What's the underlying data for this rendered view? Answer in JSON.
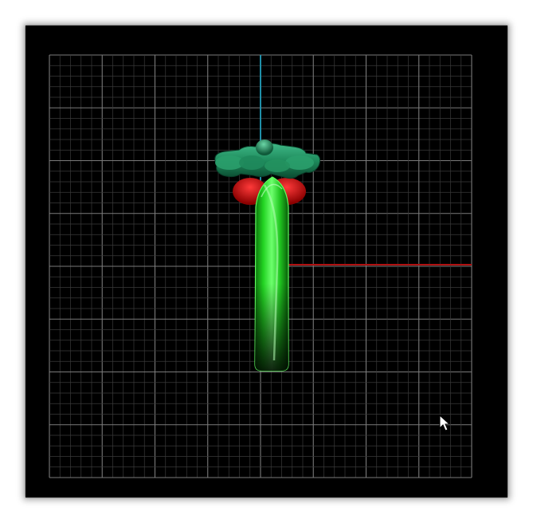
{
  "scene": {
    "background_color": "#000000",
    "grid_color_minor": "#3a3a3a",
    "grid_color_major": "#7a7a7a",
    "vertical_axis_color": "#1f8fa8",
    "horizontal_axis_color": "#b01010",
    "model": {
      "name": "ring-with-flower-top",
      "shank_color": "#22e022",
      "top_color": "#1f8c5a",
      "stone_color": "#d01010"
    },
    "cursor": "arrow-cursor-icon"
  }
}
